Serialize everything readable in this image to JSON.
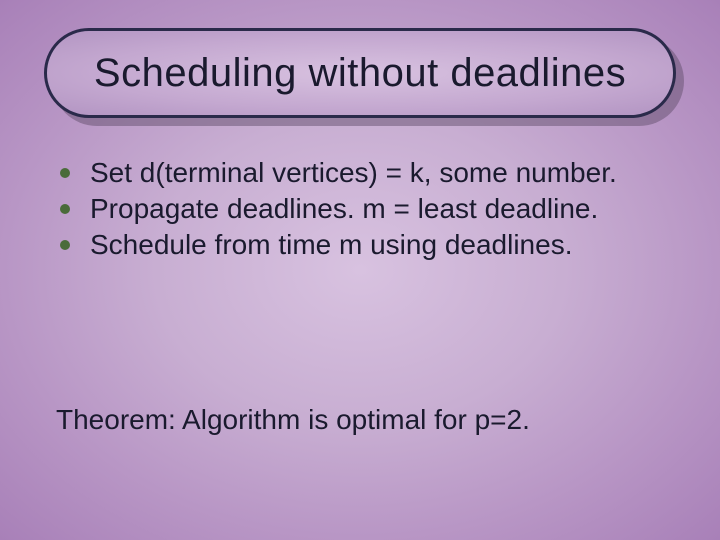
{
  "title": "Scheduling without deadlines",
  "bullets": [
    "Set d(terminal vertices) = k, some number.",
    "Propagate deadlines. m = least deadline.",
    "Schedule from time m using deadlines."
  ],
  "theorem": "Theorem: Algorithm is optimal for p=2."
}
